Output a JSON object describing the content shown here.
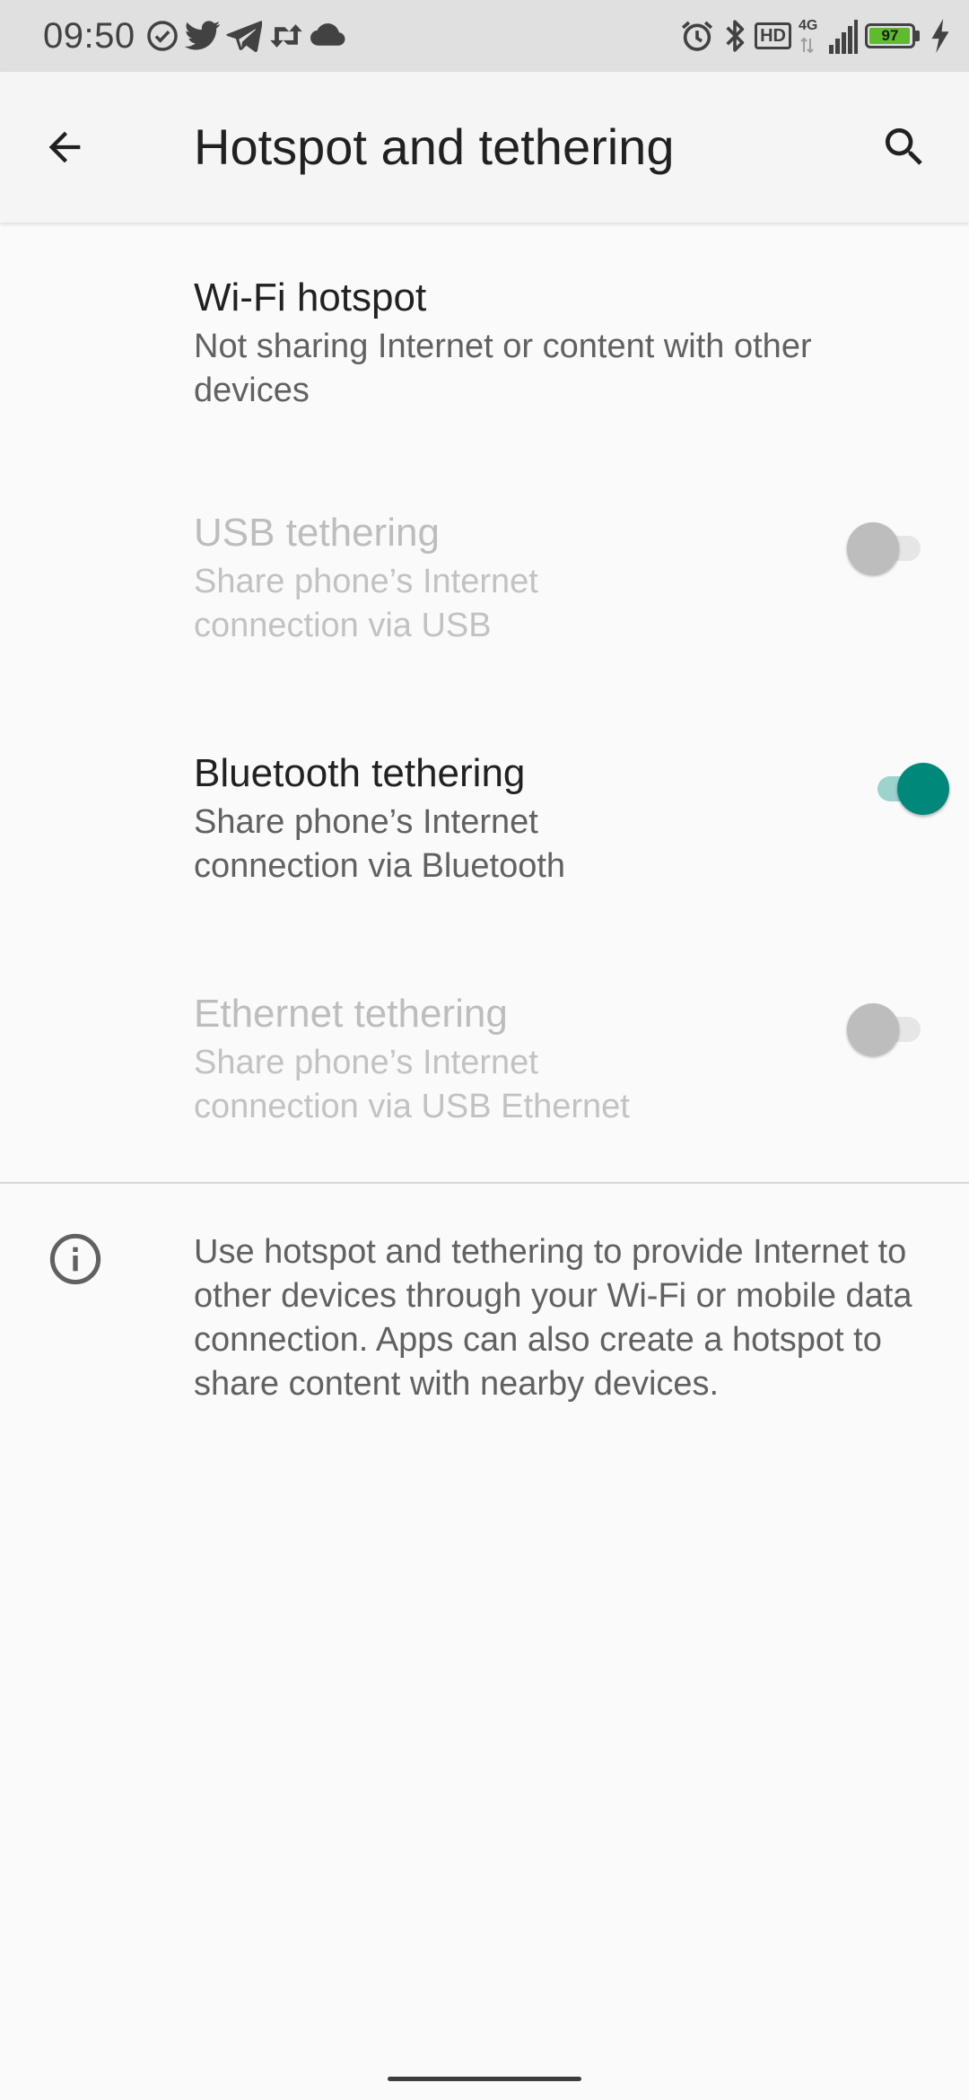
{
  "status_bar": {
    "time": "09:50",
    "net_type": "4G",
    "hd_label": "HD",
    "battery_level": "97",
    "battery_fraction": 0.97,
    "left_icons": [
      "check-circle-icon",
      "twitter-icon",
      "telegram-icon",
      "retweet-icon",
      "cloud-icon"
    ],
    "right_icons": [
      "alarm-icon",
      "bluetooth-icon",
      "hd-icon",
      "signal-icon",
      "battery-icon",
      "charging-icon"
    ]
  },
  "app_bar": {
    "title": "Hotspot and tethering",
    "back_icon": "arrow-back-icon",
    "search_icon": "search-icon"
  },
  "preferences": [
    {
      "title": "Wi-Fi hotspot",
      "summary": "Not sharing Internet or content with other devices",
      "enabled": true
    },
    {
      "title": "USB tethering",
      "summary": "Share phone’s Internet connection via USB",
      "enabled": false,
      "checked": false
    },
    {
      "title": "Bluetooth tethering",
      "summary": "Share phone’s Internet connection via Bluetooth",
      "enabled": true,
      "checked": true
    },
    {
      "title": "Ethernet tethering",
      "summary": "Share phone’s Internet connection via USB Ethernet",
      "enabled": false,
      "checked": false
    }
  ],
  "info": {
    "icon": "info-icon",
    "text": "Use hotspot and tethering to provide Internet to other devices through your Wi-Fi or mobile data connection. Apps can also create a hotspot to share content with nearby devices."
  },
  "colors": {
    "accent": "#00897b",
    "accent_track": "#9ed2cc",
    "status_bar_bg": "#e0e0e0",
    "app_bar_bg": "#f5f5f5",
    "background": "#fafafa",
    "battery_fill": "#5dbb2c"
  }
}
